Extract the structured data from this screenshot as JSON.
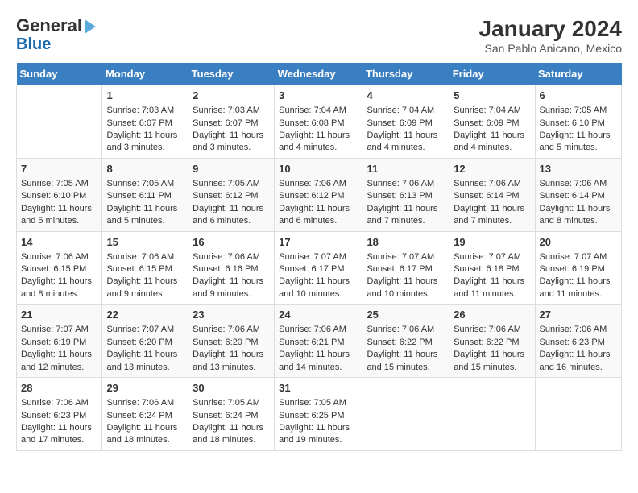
{
  "logo": {
    "line1": "General",
    "line2": "Blue"
  },
  "title": "January 2024",
  "subtitle": "San Pablo Anicano, Mexico",
  "days_of_week": [
    "Sunday",
    "Monday",
    "Tuesday",
    "Wednesday",
    "Thursday",
    "Friday",
    "Saturday"
  ],
  "weeks": [
    [
      {
        "day": "",
        "sunrise": "",
        "sunset": "",
        "daylight": ""
      },
      {
        "day": "1",
        "sunrise": "Sunrise: 7:03 AM",
        "sunset": "Sunset: 6:07 PM",
        "daylight": "Daylight: 11 hours and 3 minutes."
      },
      {
        "day": "2",
        "sunrise": "Sunrise: 7:03 AM",
        "sunset": "Sunset: 6:07 PM",
        "daylight": "Daylight: 11 hours and 3 minutes."
      },
      {
        "day": "3",
        "sunrise": "Sunrise: 7:04 AM",
        "sunset": "Sunset: 6:08 PM",
        "daylight": "Daylight: 11 hours and 4 minutes."
      },
      {
        "day": "4",
        "sunrise": "Sunrise: 7:04 AM",
        "sunset": "Sunset: 6:09 PM",
        "daylight": "Daylight: 11 hours and 4 minutes."
      },
      {
        "day": "5",
        "sunrise": "Sunrise: 7:04 AM",
        "sunset": "Sunset: 6:09 PM",
        "daylight": "Daylight: 11 hours and 4 minutes."
      },
      {
        "day": "6",
        "sunrise": "Sunrise: 7:05 AM",
        "sunset": "Sunset: 6:10 PM",
        "daylight": "Daylight: 11 hours and 5 minutes."
      }
    ],
    [
      {
        "day": "7",
        "sunrise": "Sunrise: 7:05 AM",
        "sunset": "Sunset: 6:10 PM",
        "daylight": "Daylight: 11 hours and 5 minutes."
      },
      {
        "day": "8",
        "sunrise": "Sunrise: 7:05 AM",
        "sunset": "Sunset: 6:11 PM",
        "daylight": "Daylight: 11 hours and 5 minutes."
      },
      {
        "day": "9",
        "sunrise": "Sunrise: 7:05 AM",
        "sunset": "Sunset: 6:12 PM",
        "daylight": "Daylight: 11 hours and 6 minutes."
      },
      {
        "day": "10",
        "sunrise": "Sunrise: 7:06 AM",
        "sunset": "Sunset: 6:12 PM",
        "daylight": "Daylight: 11 hours and 6 minutes."
      },
      {
        "day": "11",
        "sunrise": "Sunrise: 7:06 AM",
        "sunset": "Sunset: 6:13 PM",
        "daylight": "Daylight: 11 hours and 7 minutes."
      },
      {
        "day": "12",
        "sunrise": "Sunrise: 7:06 AM",
        "sunset": "Sunset: 6:14 PM",
        "daylight": "Daylight: 11 hours and 7 minutes."
      },
      {
        "day": "13",
        "sunrise": "Sunrise: 7:06 AM",
        "sunset": "Sunset: 6:14 PM",
        "daylight": "Daylight: 11 hours and 8 minutes."
      }
    ],
    [
      {
        "day": "14",
        "sunrise": "Sunrise: 7:06 AM",
        "sunset": "Sunset: 6:15 PM",
        "daylight": "Daylight: 11 hours and 8 minutes."
      },
      {
        "day": "15",
        "sunrise": "Sunrise: 7:06 AM",
        "sunset": "Sunset: 6:15 PM",
        "daylight": "Daylight: 11 hours and 9 minutes."
      },
      {
        "day": "16",
        "sunrise": "Sunrise: 7:06 AM",
        "sunset": "Sunset: 6:16 PM",
        "daylight": "Daylight: 11 hours and 9 minutes."
      },
      {
        "day": "17",
        "sunrise": "Sunrise: 7:07 AM",
        "sunset": "Sunset: 6:17 PM",
        "daylight": "Daylight: 11 hours and 10 minutes."
      },
      {
        "day": "18",
        "sunrise": "Sunrise: 7:07 AM",
        "sunset": "Sunset: 6:17 PM",
        "daylight": "Daylight: 11 hours and 10 minutes."
      },
      {
        "day": "19",
        "sunrise": "Sunrise: 7:07 AM",
        "sunset": "Sunset: 6:18 PM",
        "daylight": "Daylight: 11 hours and 11 minutes."
      },
      {
        "day": "20",
        "sunrise": "Sunrise: 7:07 AM",
        "sunset": "Sunset: 6:19 PM",
        "daylight": "Daylight: 11 hours and 11 minutes."
      }
    ],
    [
      {
        "day": "21",
        "sunrise": "Sunrise: 7:07 AM",
        "sunset": "Sunset: 6:19 PM",
        "daylight": "Daylight: 11 hours and 12 minutes."
      },
      {
        "day": "22",
        "sunrise": "Sunrise: 7:07 AM",
        "sunset": "Sunset: 6:20 PM",
        "daylight": "Daylight: 11 hours and 13 minutes."
      },
      {
        "day": "23",
        "sunrise": "Sunrise: 7:06 AM",
        "sunset": "Sunset: 6:20 PM",
        "daylight": "Daylight: 11 hours and 13 minutes."
      },
      {
        "day": "24",
        "sunrise": "Sunrise: 7:06 AM",
        "sunset": "Sunset: 6:21 PM",
        "daylight": "Daylight: 11 hours and 14 minutes."
      },
      {
        "day": "25",
        "sunrise": "Sunrise: 7:06 AM",
        "sunset": "Sunset: 6:22 PM",
        "daylight": "Daylight: 11 hours and 15 minutes."
      },
      {
        "day": "26",
        "sunrise": "Sunrise: 7:06 AM",
        "sunset": "Sunset: 6:22 PM",
        "daylight": "Daylight: 11 hours and 15 minutes."
      },
      {
        "day": "27",
        "sunrise": "Sunrise: 7:06 AM",
        "sunset": "Sunset: 6:23 PM",
        "daylight": "Daylight: 11 hours and 16 minutes."
      }
    ],
    [
      {
        "day": "28",
        "sunrise": "Sunrise: 7:06 AM",
        "sunset": "Sunset: 6:23 PM",
        "daylight": "Daylight: 11 hours and 17 minutes."
      },
      {
        "day": "29",
        "sunrise": "Sunrise: 7:06 AM",
        "sunset": "Sunset: 6:24 PM",
        "daylight": "Daylight: 11 hours and 18 minutes."
      },
      {
        "day": "30",
        "sunrise": "Sunrise: 7:05 AM",
        "sunset": "Sunset: 6:24 PM",
        "daylight": "Daylight: 11 hours and 18 minutes."
      },
      {
        "day": "31",
        "sunrise": "Sunrise: 7:05 AM",
        "sunset": "Sunset: 6:25 PM",
        "daylight": "Daylight: 11 hours and 19 minutes."
      },
      {
        "day": "",
        "sunrise": "",
        "sunset": "",
        "daylight": ""
      },
      {
        "day": "",
        "sunrise": "",
        "sunset": "",
        "daylight": ""
      },
      {
        "day": "",
        "sunrise": "",
        "sunset": "",
        "daylight": ""
      }
    ]
  ]
}
